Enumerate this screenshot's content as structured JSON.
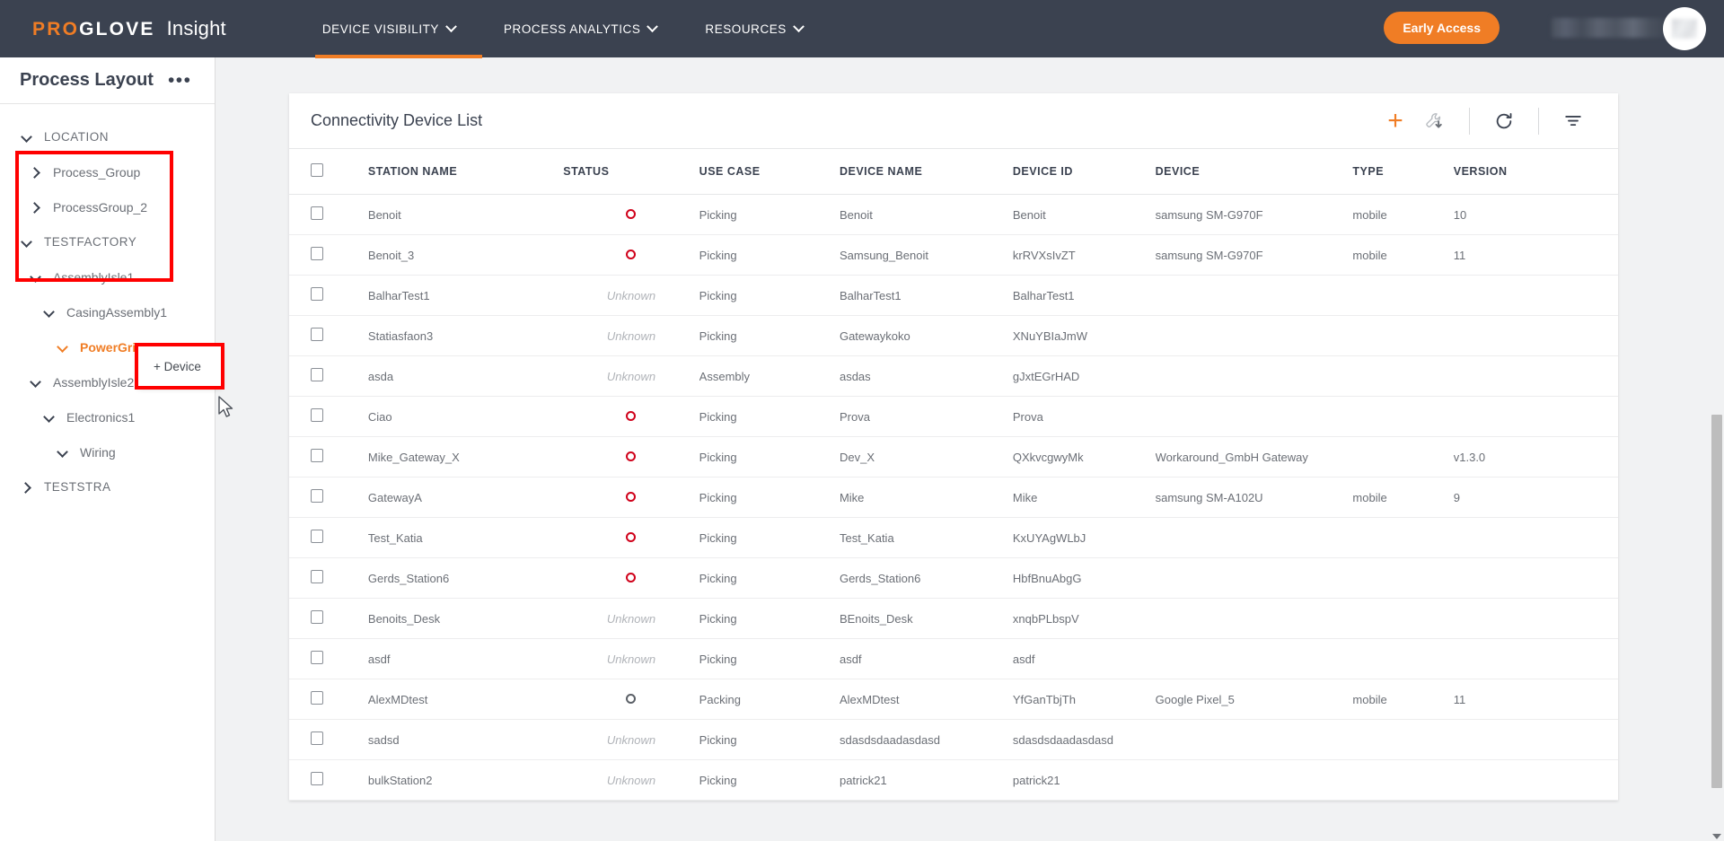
{
  "header": {
    "brand_pro": "PRO",
    "brand_glove": "GLOVE",
    "product": "Insight",
    "nav": [
      {
        "label": "DEVICE VISIBILITY",
        "active": true
      },
      {
        "label": "PROCESS ANALYTICS",
        "active": false
      },
      {
        "label": "RESOURCES",
        "active": false
      }
    ],
    "early_access_label": "Early Access",
    "accent_color": "#f07d25",
    "bar_color": "#3b4250"
  },
  "sidebar": {
    "title": "Process Layout",
    "more_label": "•••",
    "tree": [
      {
        "label": "LOCATION",
        "indent": 0,
        "expanded": true,
        "section": true,
        "active": false
      },
      {
        "label": "Process_Group",
        "indent": 1,
        "expanded": false,
        "section": false,
        "active": false
      },
      {
        "label": "ProcessGroup_2",
        "indent": 1,
        "expanded": false,
        "section": false,
        "active": false
      },
      {
        "label": "TESTFACTORY",
        "indent": 0,
        "expanded": true,
        "section": true,
        "active": false
      },
      {
        "label": "AssemblyIsle1",
        "indent": 1,
        "expanded": true,
        "section": false,
        "active": false
      },
      {
        "label": "CasingAssembly1",
        "indent": 2,
        "expanded": true,
        "section": false,
        "active": false
      },
      {
        "label": "PowerGrid",
        "indent": 3,
        "expanded": true,
        "section": false,
        "active": true,
        "dots": true
      },
      {
        "label": "AssemblyIsle2",
        "indent": 1,
        "expanded": true,
        "section": false,
        "active": false
      },
      {
        "label": "Electronics1",
        "indent": 2,
        "expanded": true,
        "section": false,
        "active": false
      },
      {
        "label": "Wiring",
        "indent": 3,
        "expanded": true,
        "section": false,
        "active": false
      },
      {
        "label": "TESTSTRA",
        "indent": 0,
        "expanded": false,
        "section": true,
        "active": false
      }
    ],
    "context_menu": {
      "add_device_label": "+ Device"
    },
    "annotation_color": "#ff0000"
  },
  "main": {
    "card_title": "Connectivity Device List",
    "toolbar": {
      "add": "add-icon",
      "configure": "wrench-download-icon",
      "refresh": "refresh-icon",
      "filter": "filter-icon"
    },
    "table": {
      "columns": [
        "",
        "STATION NAME",
        "STATUS",
        "USE CASE",
        "DEVICE NAME",
        "DEVICE ID",
        "DEVICE",
        "TYPE",
        "VERSION"
      ],
      "rows": [
        {
          "station": "Benoit",
          "status": "offline",
          "use_case": "Picking",
          "device_name": "Benoit",
          "device_id": "Benoit",
          "device": "samsung SM-G970F",
          "type": "mobile",
          "version": "10"
        },
        {
          "station": "Benoit_3",
          "status": "offline",
          "use_case": "Picking",
          "device_name": "Samsung_Benoit",
          "device_id": "krRVXsIvZT",
          "device": "samsung SM-G970F",
          "type": "mobile",
          "version": "11"
        },
        {
          "station": "BalharTest1",
          "status": "unknown",
          "use_case": "Picking",
          "device_name": "BalharTest1",
          "device_id": "BalharTest1",
          "device": "",
          "type": "",
          "version": ""
        },
        {
          "station": "Statiasfaon3",
          "status": "unknown",
          "use_case": "Picking",
          "device_name": "Gatewaykoko",
          "device_id": "XNuYBIaJmW",
          "device": "",
          "type": "",
          "version": ""
        },
        {
          "station": "asda",
          "status": "unknown",
          "use_case": "Assembly",
          "device_name": "asdas",
          "device_id": "gJxtEGrHAD",
          "device": "",
          "type": "",
          "version": ""
        },
        {
          "station": "Ciao",
          "status": "offline",
          "use_case": "Picking",
          "device_name": "Prova",
          "device_id": "Prova",
          "device": "",
          "type": "",
          "version": ""
        },
        {
          "station": "Mike_Gateway_X",
          "status": "offline",
          "use_case": "Picking",
          "device_name": "Dev_X",
          "device_id": "QXkvcgwyMk",
          "device": "Workaround_GmbH Gateway",
          "type": "",
          "version": "v1.3.0"
        },
        {
          "station": "GatewayA",
          "status": "offline",
          "use_case": "Picking",
          "device_name": "Mike",
          "device_id": "Mike",
          "device": "samsung SM-A102U",
          "type": "mobile",
          "version": "9"
        },
        {
          "station": "Test_Katia",
          "status": "offline",
          "use_case": "Picking",
          "device_name": "Test_Katia",
          "device_id": "KxUYAgWLbJ",
          "device": "",
          "type": "",
          "version": ""
        },
        {
          "station": "Gerds_Station6",
          "status": "offline",
          "use_case": "Picking",
          "device_name": "Gerds_Station6",
          "device_id": "HbfBnuAbgG",
          "device": "",
          "type": "",
          "version": ""
        },
        {
          "station": "Benoits_Desk",
          "status": "unknown",
          "use_case": "Picking",
          "device_name": "BEnoits_Desk",
          "device_id": "xnqbPLbspV",
          "device": "",
          "type": "",
          "version": ""
        },
        {
          "station": "asdf",
          "status": "unknown",
          "use_case": "Picking",
          "device_name": "asdf",
          "device_id": "asdf",
          "device": "",
          "type": "",
          "version": ""
        },
        {
          "station": "AlexMDtest",
          "status": "grey",
          "use_case": "Packing",
          "device_name": "AlexMDtest",
          "device_id": "YfGanTbjTh",
          "device": "Google Pixel_5",
          "type": "mobile",
          "version": "11"
        },
        {
          "station": "sadsd",
          "status": "unknown",
          "use_case": "Picking",
          "device_name": "sdasdsdaadasdasd",
          "device_id": "sdasdsdaadasdasd",
          "device": "",
          "type": "",
          "version": ""
        },
        {
          "station": "bulkStation2",
          "status": "unknown",
          "use_case": "Picking",
          "device_name": "patrick21",
          "device_id": "patrick21",
          "device": "",
          "type": "",
          "version": ""
        }
      ],
      "status_label_unknown": "Unknown",
      "status_color_offline": "#d0021b",
      "status_color_grey": "#5b6067"
    }
  }
}
